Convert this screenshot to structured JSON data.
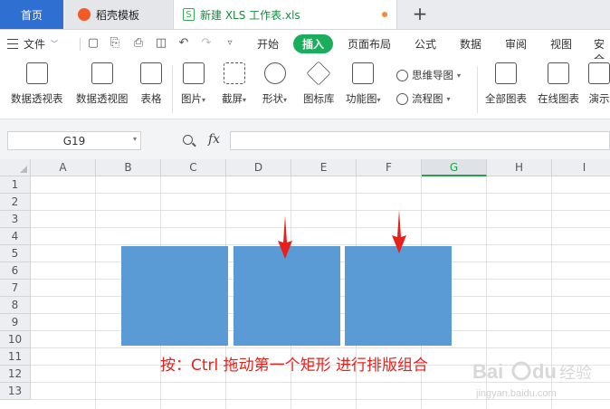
{
  "tabs": {
    "home": "首页",
    "daoke": "稻壳模板",
    "file": "新建 XLS 工作表.xls",
    "add": "+"
  },
  "menu": {
    "file": "文件",
    "items": [
      "开始",
      "插入",
      "页面布局",
      "公式",
      "数据",
      "审阅",
      "视图",
      "安全"
    ]
  },
  "ribbon": {
    "pivot_table": "数据透视表",
    "pivot_chart": "数据透视图",
    "table": "表格",
    "picture": "图片",
    "screenshot": "截屏",
    "shape": "形状",
    "icon_lib": "图标库",
    "func_chart": "功能图",
    "mindmap": "思维导图",
    "flowchart": "流程图",
    "all_charts": "全部图表",
    "online_chart": "在线图表",
    "demo": "演示"
  },
  "formula_bar": {
    "cell_ref": "G19",
    "fx": "fx",
    "value": ""
  },
  "grid": {
    "columns": [
      "A",
      "B",
      "C",
      "D",
      "E",
      "F",
      "G",
      "H",
      "I"
    ],
    "selected_column": "G",
    "rows": [
      "1",
      "2",
      "3",
      "4",
      "5",
      "6",
      "7",
      "8",
      "9",
      "10",
      "11",
      "12",
      "13"
    ]
  },
  "annotation": {
    "text": "按：Ctrl 拖动第一个矩形 进行排版组合",
    "color": "#e8201a"
  },
  "shapes": {
    "fill": "#5b9bd5"
  },
  "watermark": {
    "brand": "Bai du 经验",
    "url": "jingyan.baidu.com"
  }
}
